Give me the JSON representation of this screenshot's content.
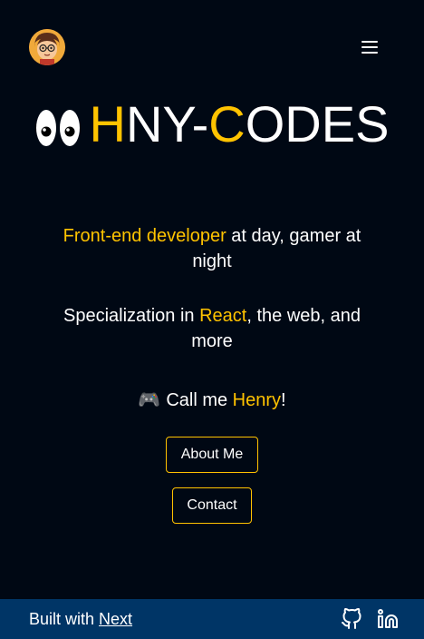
{
  "header": {
    "avatar_alt": "Henry avatar",
    "menu_icon": "hamburger-menu-icon"
  },
  "logo": {
    "icon": "eyes-icon",
    "letter_h": "H",
    "part_1": "NY-",
    "letter_c": "C",
    "part_2": "ODES"
  },
  "tagline_1": {
    "highlight": "Front-end developer",
    "rest": " at day, gamer at night"
  },
  "tagline_2": {
    "prefix": "Specialization in ",
    "highlight": "React",
    "rest": ", the web, and more"
  },
  "callme": {
    "icon": "🎮",
    "prefix": "Call me ",
    "name": "Henry",
    "suffix": "!"
  },
  "buttons": {
    "about": "About Me",
    "contact": "Contact"
  },
  "footer": {
    "prefix": "Built with ",
    "link": "Next",
    "icons": [
      "github-icon",
      "linkedin-icon"
    ]
  },
  "colors": {
    "background": "#000814",
    "accent": "#ffc300",
    "footer": "#003566",
    "text": "#ffffff"
  }
}
